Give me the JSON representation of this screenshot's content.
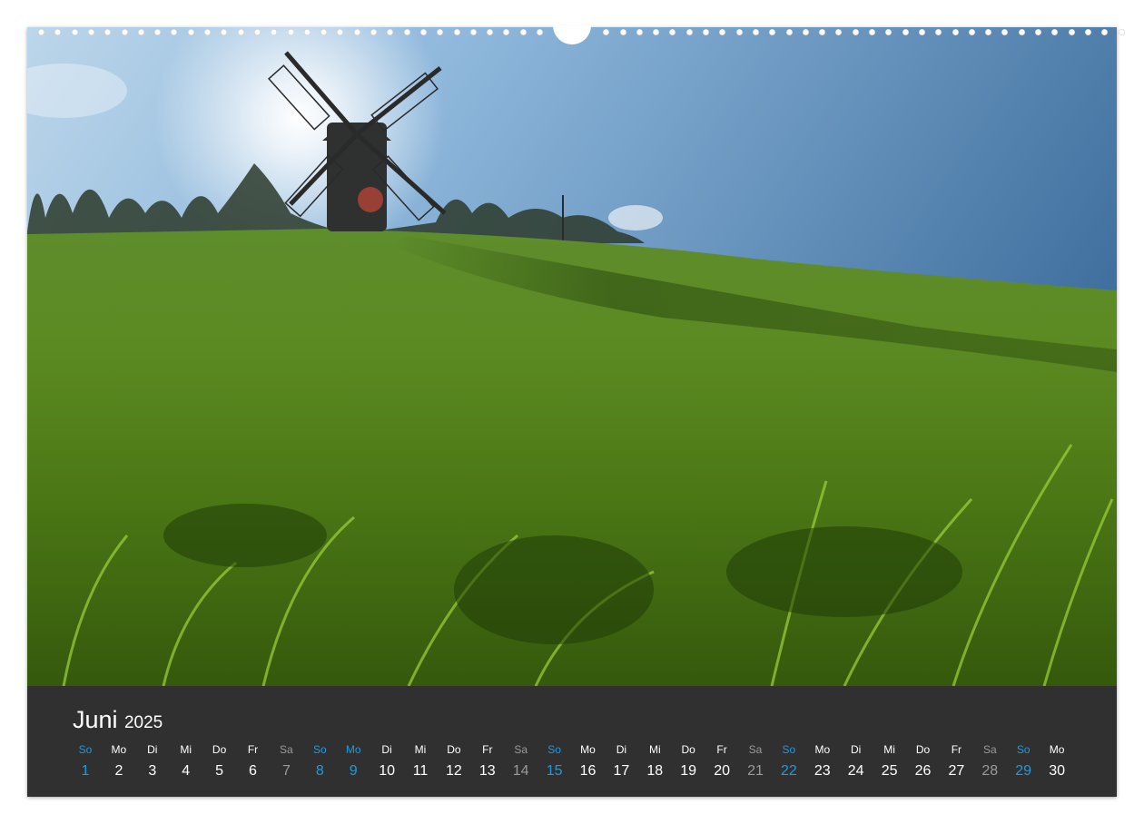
{
  "calendar": {
    "month": "Juni",
    "year": "2025",
    "days": [
      {
        "weekday": "So",
        "day": "1",
        "kind": "sun"
      },
      {
        "weekday": "Mo",
        "day": "2",
        "kind": "week"
      },
      {
        "weekday": "Di",
        "day": "3",
        "kind": "week"
      },
      {
        "weekday": "Mi",
        "day": "4",
        "kind": "week"
      },
      {
        "weekday": "Do",
        "day": "5",
        "kind": "week"
      },
      {
        "weekday": "Fr",
        "day": "6",
        "kind": "week"
      },
      {
        "weekday": "Sa",
        "day": "7",
        "kind": "sat"
      },
      {
        "weekday": "So",
        "day": "8",
        "kind": "sun"
      },
      {
        "weekday": "Mo",
        "day": "9",
        "kind": "sun"
      },
      {
        "weekday": "Di",
        "day": "10",
        "kind": "week"
      },
      {
        "weekday": "Mi",
        "day": "11",
        "kind": "week"
      },
      {
        "weekday": "Do",
        "day": "12",
        "kind": "week"
      },
      {
        "weekday": "Fr",
        "day": "13",
        "kind": "week"
      },
      {
        "weekday": "Sa",
        "day": "14",
        "kind": "sat"
      },
      {
        "weekday": "So",
        "day": "15",
        "kind": "sun"
      },
      {
        "weekday": "Mo",
        "day": "16",
        "kind": "week"
      },
      {
        "weekday": "Di",
        "day": "17",
        "kind": "week"
      },
      {
        "weekday": "Mi",
        "day": "18",
        "kind": "week"
      },
      {
        "weekday": "Do",
        "day": "19",
        "kind": "week"
      },
      {
        "weekday": "Fr",
        "day": "20",
        "kind": "week"
      },
      {
        "weekday": "Sa",
        "day": "21",
        "kind": "sat"
      },
      {
        "weekday": "So",
        "day": "22",
        "kind": "sun"
      },
      {
        "weekday": "Mo",
        "day": "23",
        "kind": "week"
      },
      {
        "weekday": "Di",
        "day": "24",
        "kind": "week"
      },
      {
        "weekday": "Mi",
        "day": "25",
        "kind": "week"
      },
      {
        "weekday": "Do",
        "day": "26",
        "kind": "week"
      },
      {
        "weekday": "Fr",
        "day": "27",
        "kind": "week"
      },
      {
        "weekday": "Sa",
        "day": "28",
        "kind": "sat"
      },
      {
        "weekday": "So",
        "day": "29",
        "kind": "sun"
      },
      {
        "weekday": "Mo",
        "day": "30",
        "kind": "week"
      }
    ]
  },
  "colors": {
    "band": "#303030",
    "sunday_accent": "#1e9be0",
    "saturday_gray": "#9a9a9a",
    "weekday_text": "#ffffff"
  },
  "photo": {
    "subject": "windmill-on-grassy-hill-icon"
  }
}
